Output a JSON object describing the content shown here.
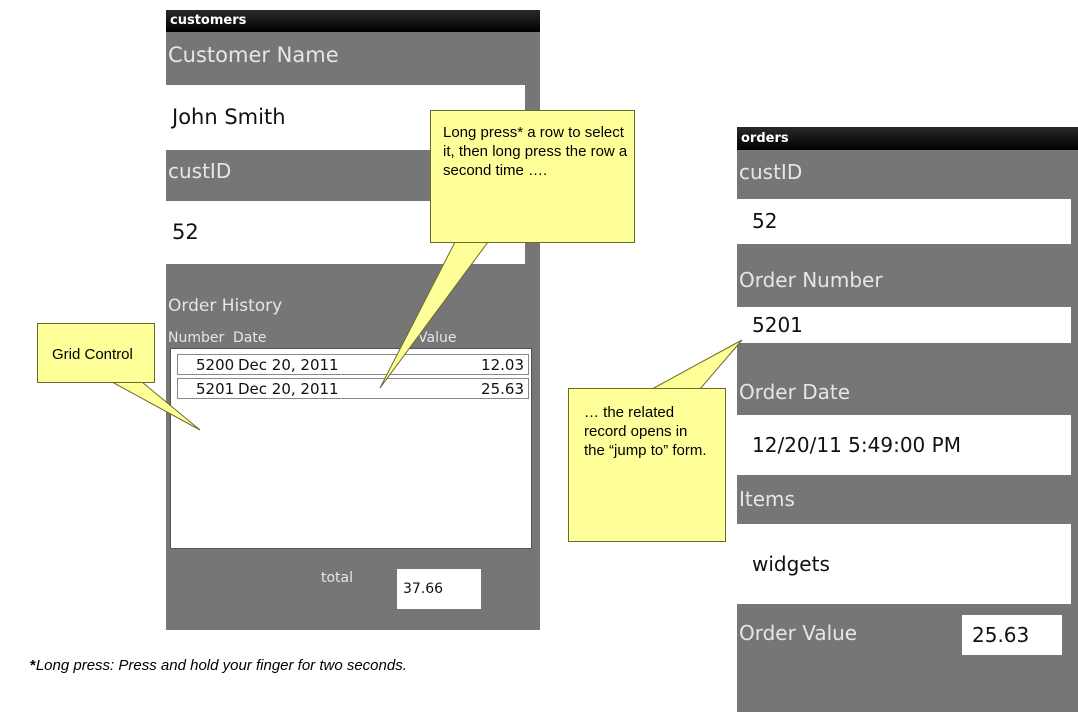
{
  "customers": {
    "title": "customers",
    "customer_name_label": "Customer Name",
    "customer_name_value": "John Smith",
    "cust_id_label": "custID",
    "cust_id_value": "52",
    "order_history_label": "Order History",
    "grid": {
      "columns": [
        "Number",
        "Date",
        "Value"
      ],
      "rows": [
        {
          "number": "5200",
          "date": "Dec 20, 2011",
          "value": "12.03"
        },
        {
          "number": "5201",
          "date": "Dec 20, 2011",
          "value": "25.63"
        }
      ]
    },
    "total_label": "total",
    "total_value": "37.66"
  },
  "orders": {
    "title": "orders",
    "cust_id_label": "custID",
    "cust_id_value": "52",
    "order_number_label": "Order Number",
    "order_number_value": "5201",
    "order_date_label": "Order Date",
    "order_date_value": "12/20/11 5:49:00 PM",
    "items_label": "Items",
    "items_value": "widgets",
    "order_value_label": "Order Value",
    "order_value_value": "25.63"
  },
  "callouts": {
    "grid_control": "Grid Control",
    "long_press": "Long press* a row to select it, then long press the row a second time ….",
    "related_record": "… the related record opens in the “jump to” form."
  },
  "footnote": {
    "star": "*",
    "text": "Long press: Press and hold your finger for two seconds."
  },
  "colors": {
    "screen_bg": "#767676",
    "callout_bg": "#ffff99",
    "titlebar_bg": "#000000"
  }
}
